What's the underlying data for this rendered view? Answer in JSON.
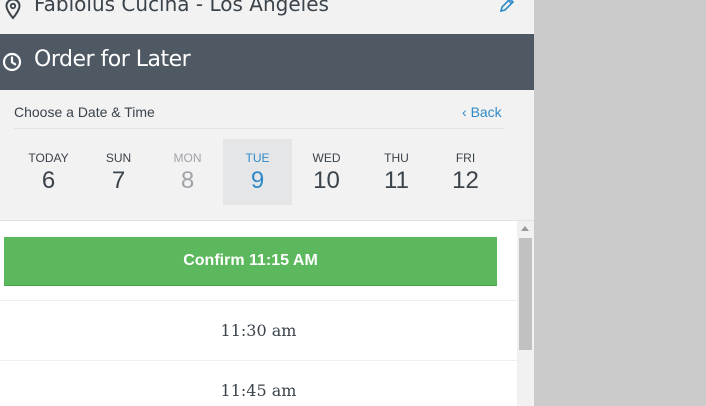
{
  "restaurant": {
    "name": "Fabiolus Cucina - Los Angeles"
  },
  "header": {
    "title": "Order for Later"
  },
  "date_picker": {
    "choose_label": "Choose a Date & Time",
    "back_label": "Back",
    "days": [
      {
        "name": "TODAY",
        "num": "6",
        "state": "normal"
      },
      {
        "name": "SUN",
        "num": "7",
        "state": "normal"
      },
      {
        "name": "MON",
        "num": "8",
        "state": "disabled"
      },
      {
        "name": "TUE",
        "num": "9",
        "state": "selected"
      },
      {
        "name": "WED",
        "num": "10",
        "state": "normal"
      },
      {
        "name": "THU",
        "num": "11",
        "state": "normal"
      },
      {
        "name": "FRI",
        "num": "12",
        "state": "normal"
      }
    ]
  },
  "times": {
    "confirm_label": "Confirm 11:15 AM",
    "options": [
      "11:30 am",
      "11:45 am"
    ]
  },
  "colors": {
    "accent": "#2f8ac8",
    "confirm": "#5cb85c",
    "header_bg": "#4f5963"
  }
}
